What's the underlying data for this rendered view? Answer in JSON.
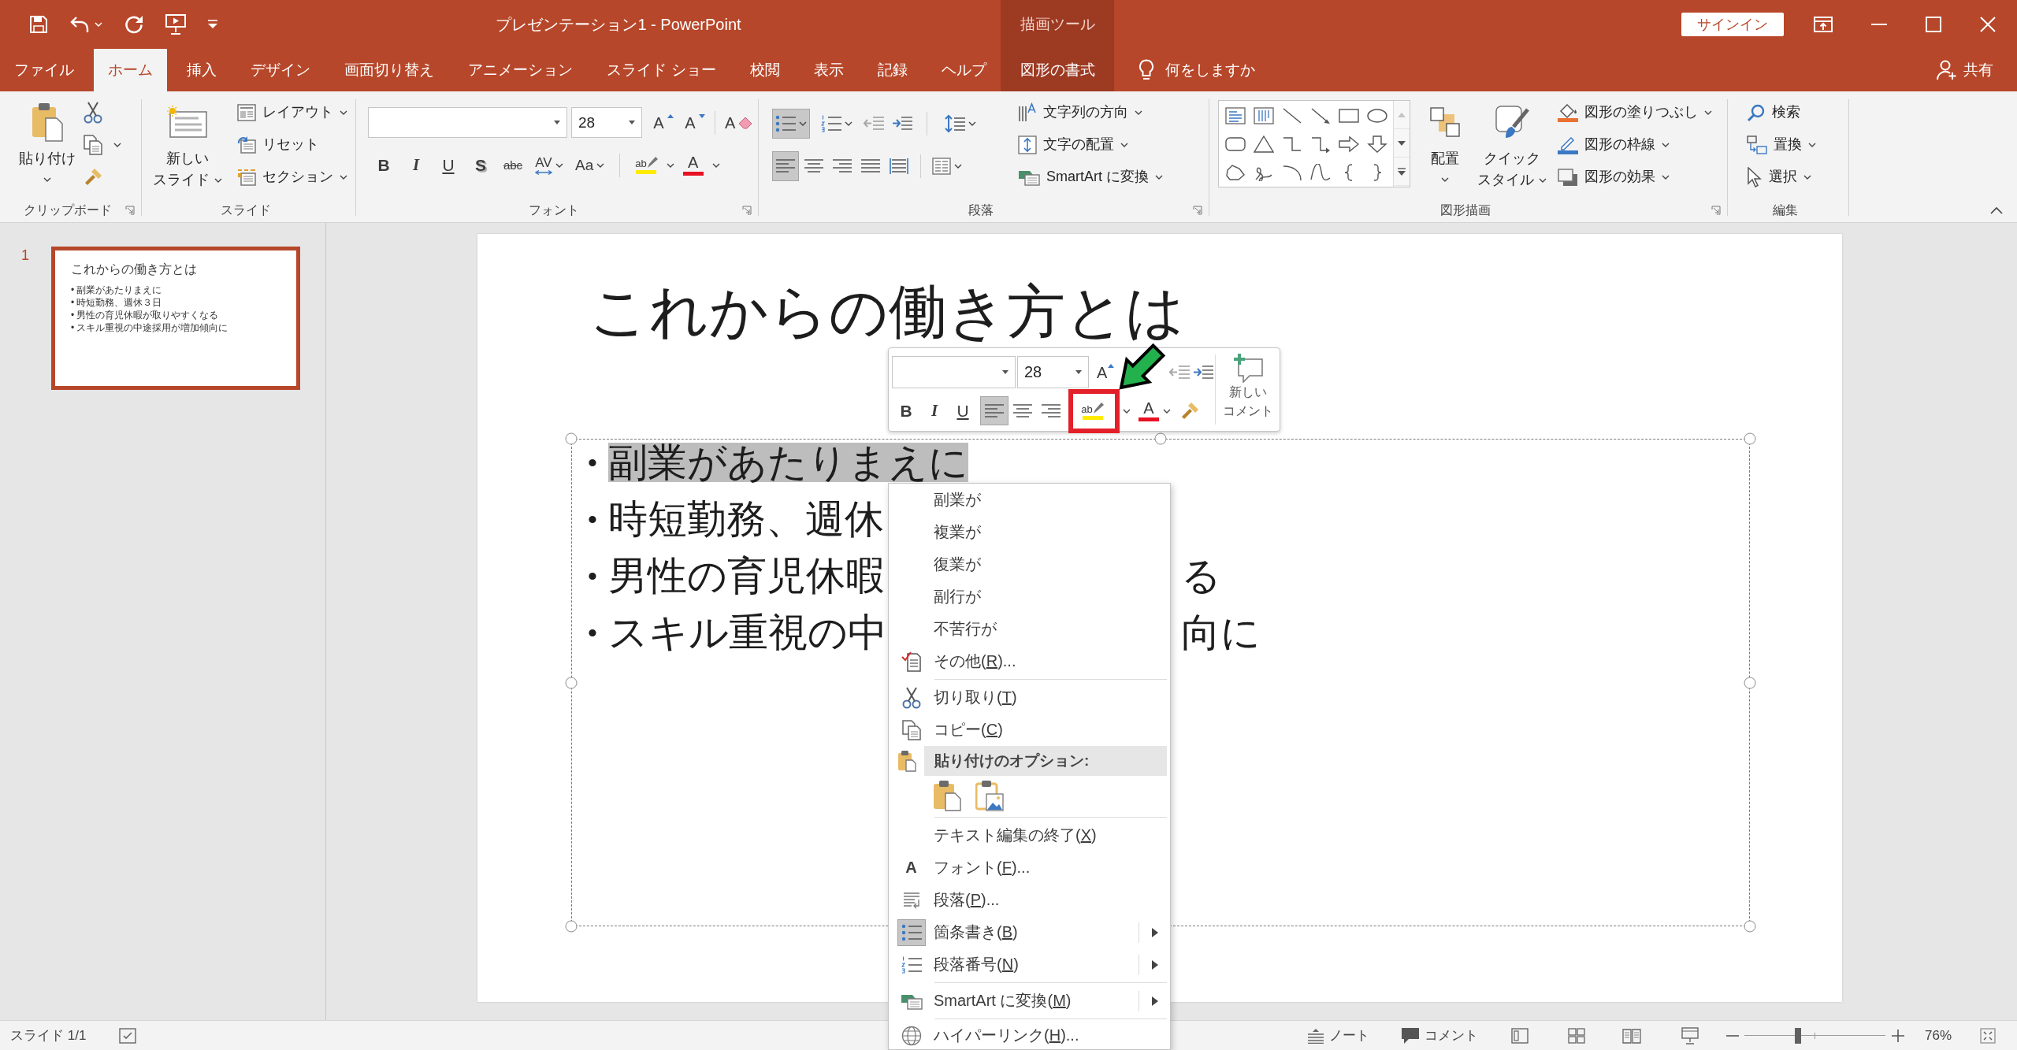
{
  "title_bar": {
    "title": "プレゼンテーション1 - PowerPoint",
    "tool_group": "描画ツール",
    "sign_in": "サインイン"
  },
  "tabs": [
    {
      "label": "ファイル",
      "kind": "standard",
      "selected": false
    },
    {
      "label": "ホーム",
      "kind": "standard",
      "selected": true
    },
    {
      "label": "挿入",
      "kind": "standard",
      "selected": false
    },
    {
      "label": "デザイン",
      "kind": "standard",
      "selected": false
    },
    {
      "label": "画面切り替え",
      "kind": "standard",
      "selected": false
    },
    {
      "label": "アニメーション",
      "kind": "standard",
      "selected": false
    },
    {
      "label": "スライド ショー",
      "kind": "standard",
      "selected": false
    },
    {
      "label": "校閲",
      "kind": "standard",
      "selected": false
    },
    {
      "label": "表示",
      "kind": "standard",
      "selected": false
    },
    {
      "label": "記録",
      "kind": "standard",
      "selected": false
    },
    {
      "label": "ヘルプ",
      "kind": "standard",
      "selected": false
    },
    {
      "label": "図形の書式",
      "kind": "contextual",
      "selected": false
    }
  ],
  "tell_me": {
    "placeholder": "何をしますか"
  },
  "share": "共有",
  "ribbon": {
    "clipboard": {
      "paste": "貼り付け",
      "label": "クリップボード"
    },
    "slides": {
      "new_slide": [
        "新しい",
        "スライド"
      ],
      "commands": [
        {
          "kind": "layout",
          "label": "レイアウト",
          "dropdown": true
        },
        {
          "kind": "reset",
          "label": "リセット",
          "dropdown": false
        },
        {
          "kind": "section",
          "label": "セクション",
          "dropdown": true
        }
      ],
      "label": "スライド"
    },
    "font": {
      "size": "28",
      "size_buttons": [
        {
          "kind": "grow",
          "glyph": "A"
        },
        {
          "kind": "shrink",
          "glyph": "A"
        }
      ],
      "clear": {
        "glyph": "A"
      },
      "styles": [
        {
          "kind": "bold",
          "glyph": "B",
          "selected": false,
          "dropdown": false
        },
        {
          "kind": "italic",
          "glyph": "I",
          "selected": false,
          "dropdown": false
        },
        {
          "kind": "underline",
          "glyph": "U",
          "selected": false,
          "dropdown": false
        },
        {
          "kind": "shadow",
          "glyph": "S",
          "selected": false,
          "dropdown": false
        },
        {
          "kind": "strike",
          "glyph": "abc",
          "selected": false,
          "dropdown": false
        },
        {
          "kind": "spacing",
          "glyph": "AV",
          "selected": false,
          "dropdown": true
        },
        {
          "kind": "case",
          "glyph": "Aa",
          "selected": false,
          "dropdown": true
        }
      ],
      "highlight": {
        "glyph": "ab"
      },
      "font_color": {
        "glyph": "A"
      },
      "label": "フォント"
    },
    "paragraph": {
      "lists": [
        {
          "kind": "bullets",
          "selected": true
        },
        {
          "kind": "numbering",
          "selected": false
        }
      ],
      "alignment": [
        {
          "kind": "left",
          "selected": true
        },
        {
          "kind": "center",
          "selected": false
        },
        {
          "kind": "right",
          "selected": false
        },
        {
          "kind": "justify",
          "selected": false
        },
        {
          "kind": "distributed",
          "selected": false
        }
      ],
      "commands": [
        {
          "kind": "direction",
          "label": "文字列の方向"
        },
        {
          "kind": "align",
          "label": "文字の配置"
        },
        {
          "kind": "smartart",
          "label": "SmartArt に変換"
        }
      ],
      "label": "段落"
    },
    "drawing": {
      "arrange": "配置",
      "quick_styles": [
        "クイック",
        "スタイル"
      ],
      "commands": [
        {
          "kind": "fill",
          "label": "図形の塗りつぶし"
        },
        {
          "kind": "outline",
          "label": "図形の枠線"
        },
        {
          "kind": "effects",
          "label": "図形の効果"
        }
      ],
      "label": "図形描画"
    },
    "editing": {
      "commands": [
        {
          "kind": "find",
          "label": "検索",
          "dropdown": false
        },
        {
          "kind": "replace",
          "label": "置換",
          "dropdown": true
        },
        {
          "kind": "select",
          "label": "選択",
          "dropdown": true
        }
      ],
      "label": "編集"
    }
  },
  "slide_pane": {
    "number": "1",
    "selected": true,
    "title": "これからの働き方とは",
    "bullets": [
      {
        "marker": "•",
        "text": "副業があたりまえに"
      },
      {
        "marker": "•",
        "text": "時短勤務、週休３日"
      },
      {
        "marker": "•",
        "text": "男性の育児休暇が取りやすくなる"
      },
      {
        "marker": "•",
        "text": "スキル重視の中途採用が増加傾向に"
      }
    ]
  },
  "slide": {
    "title": "これからの働き方とは",
    "body": [
      {
        "marker": "•",
        "text": "副業があたりまえに",
        "selected": true
      },
      {
        "marker": "•",
        "text": "時短勤務、週休",
        "selected": false
      },
      {
        "marker": "•",
        "text": "男性の育児休暇",
        "visible_end": "る",
        "selected": false
      },
      {
        "marker": "•",
        "text": "スキル重視の中",
        "visible_end": "向に",
        "selected": false
      }
    ]
  },
  "mini_toolbar": {
    "size": "28",
    "grow": {
      "glyph": "A"
    },
    "styles": [
      {
        "kind": "bold",
        "glyph": "B",
        "selected": false,
        "dropdown": false
      },
      {
        "kind": "italic",
        "glyph": "I",
        "selected": false,
        "dropdown": false
      },
      {
        "kind": "underline",
        "glyph": "U",
        "selected": false,
        "dropdown": false
      }
    ],
    "alignment": [
      {
        "kind": "left",
        "selected": true
      },
      {
        "kind": "center",
        "selected": false
      },
      {
        "kind": "right",
        "selected": false
      }
    ],
    "highlight": {
      "glyph": "ab"
    },
    "font_color": {
      "glyph": "A"
    },
    "new_comment": [
      "新しい",
      "コメント"
    ]
  },
  "context_menu": [
    {
      "kind": "suggestion",
      "label": "副業が"
    },
    {
      "kind": "suggestion",
      "label": "複業が"
    },
    {
      "kind": "suggestion",
      "label": "復業が"
    },
    {
      "kind": "suggestion",
      "label": "副行が"
    },
    {
      "kind": "suggestion",
      "label": "不苦行が"
    },
    {
      "kind": "spelling",
      "label": "その他(R)...",
      "submenu": false,
      "checked": false
    },
    {
      "kind": "separator"
    },
    {
      "kind": "cut",
      "label": "切り取り(T)",
      "submenu": false,
      "checked": false
    },
    {
      "kind": "copy",
      "label": "コピー(C)",
      "submenu": false,
      "checked": false
    },
    {
      "kind": "pasteheader",
      "label": "貼り付けのオプション:"
    },
    {
      "kind": "pasteoptions"
    },
    {
      "kind": "separator"
    },
    {
      "kind": "exitedit",
      "label": "テキスト編集の終了(X)",
      "submenu": false,
      "checked": false
    },
    {
      "kind": "font",
      "glyph": "A",
      "label": "フォント(F)...",
      "submenu": false,
      "checked": false
    },
    {
      "kind": "paragraph",
      "label": "段落(P)...",
      "submenu": false,
      "checked": false
    },
    {
      "kind": "bullets",
      "label": "箇条書き(B)",
      "submenu": true,
      "checked": true
    },
    {
      "kind": "numbering",
      "label": "段落番号(N)",
      "submenu": true,
      "checked": false
    },
    {
      "kind": "separator"
    },
    {
      "kind": "smartart",
      "label": "SmartArt に変換(M)",
      "submenu": true,
      "checked": false
    },
    {
      "kind": "separator"
    },
    {
      "kind": "hyperlink",
      "label": "ハイパーリンク(H)...",
      "submenu": false,
      "checked": false
    }
  ],
  "status_bar": {
    "slide_counter": "スライド 1/1",
    "notes": "ノート",
    "comments": "コメント",
    "zoom": {
      "level": 0.38,
      "reading": "76%"
    }
  }
}
